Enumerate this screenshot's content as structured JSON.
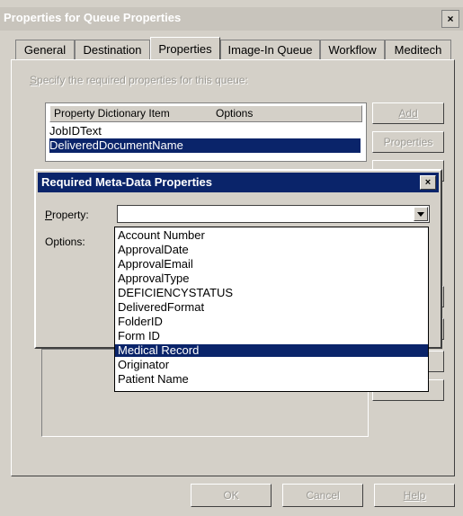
{
  "window": {
    "title": "Properties for Queue Properties",
    "close_glyph": "×"
  },
  "tabs": [
    {
      "label": "General"
    },
    {
      "label": "Destination"
    },
    {
      "label": "Properties"
    },
    {
      "label": "Image-In Queue"
    },
    {
      "label": "Workflow"
    },
    {
      "label": "Meditech"
    }
  ],
  "properties_tab": {
    "instruction_prefix": "S",
    "instruction_rest": "pecify the required properties for this queue:",
    "list": {
      "col_item": "Property Dictionary Item",
      "col_options": "Options",
      "rows": [
        "JobIDText",
        "DeliveredDocumentName"
      ],
      "selected_row": 1
    },
    "add_button": "Add",
    "properties_button": "Properties",
    "s_label": "S"
  },
  "footer": {
    "ok": "OK",
    "cancel": "Cancel",
    "help": "Help"
  },
  "dialog": {
    "title": "Required Meta-Data Properties",
    "close_glyph": "×",
    "property_label_u": "P",
    "property_label_rest": "roperty:",
    "property_value": "",
    "options_label": "Options:",
    "dropdown_options": [
      "Account Number",
      "ApprovalDate",
      "ApprovalEmail",
      "ApprovalType",
      "DEFICIENCYSTATUS",
      "DeliveredFormat",
      "FolderID",
      "Form ID",
      "Medical Record",
      "Originator",
      "Patient Name"
    ],
    "selected_option": "Medical Record"
  },
  "colors": {
    "face": "#d4d0c8",
    "selection": "#0a246a",
    "disabled_text": "#9c9a94"
  }
}
